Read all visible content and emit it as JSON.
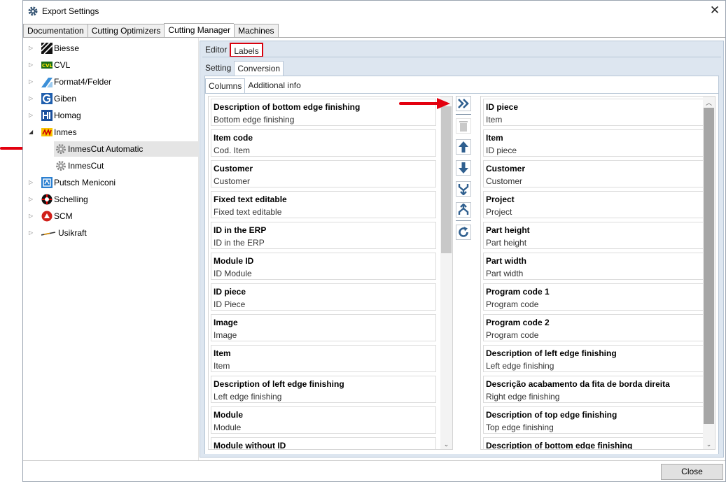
{
  "window": {
    "title": "Export Settings",
    "close_glyph": "✕"
  },
  "main_tabs": [
    {
      "label": "Documentation",
      "active": false
    },
    {
      "label": "Cutting Optimizers",
      "active": false
    },
    {
      "label": "Cutting Manager",
      "active": true
    },
    {
      "label": "Machines",
      "active": false
    }
  ],
  "tree": [
    {
      "label": "Biesse",
      "icon": "biesse-logo-icon",
      "expanded": false
    },
    {
      "label": "CVL",
      "icon": "cvl-logo-icon",
      "expanded": false
    },
    {
      "label": "Format4/Felder",
      "icon": "format4-logo-icon",
      "expanded": false
    },
    {
      "label": "Giben",
      "icon": "giben-logo-icon",
      "expanded": false
    },
    {
      "label": "Homag",
      "icon": "homag-logo-icon",
      "expanded": false
    },
    {
      "label": "Inmes",
      "icon": "inmes-logo-icon",
      "expanded": true
    },
    {
      "label": "InmesCut Automatic",
      "icon": "gear-icon",
      "child": true,
      "selected": true
    },
    {
      "label": "InmesCut",
      "icon": "gear-icon",
      "child": true
    },
    {
      "label": "Putsch Meniconi",
      "icon": "putsch-logo-icon",
      "expanded": false
    },
    {
      "label": "Schelling",
      "icon": "schelling-logo-icon",
      "expanded": false
    },
    {
      "label": "SCM",
      "icon": "scm-logo-icon",
      "expanded": false
    },
    {
      "label": "Usikraft",
      "icon": "usikraft-logo-icon",
      "expanded": false
    }
  ],
  "subtabs_level1": [
    {
      "label": "Editor"
    },
    {
      "label": "Labels",
      "active": true
    }
  ],
  "subtabs_level2": [
    {
      "label": "Setting"
    },
    {
      "label": "Conversion",
      "active": true
    }
  ],
  "subtabs_level3": [
    {
      "label": "Columns",
      "active": true
    },
    {
      "label": "Additional info"
    }
  ],
  "available_columns": [
    {
      "title": "Description of bottom edge finishing",
      "sub": "Bottom edge finishing"
    },
    {
      "title": "Item code",
      "sub": "Cod. Item"
    },
    {
      "title": "Customer",
      "sub": "Customer"
    },
    {
      "title": "Fixed text editable",
      "sub": "Fixed text editable"
    },
    {
      "title": "ID in the ERP",
      "sub": "ID in the ERP"
    },
    {
      "title": "Module ID",
      "sub": "ID Module"
    },
    {
      "title": "ID piece",
      "sub": "ID Piece"
    },
    {
      "title": "Image",
      "sub": "Image"
    },
    {
      "title": "Item",
      "sub": "Item"
    },
    {
      "title": "Description of left edge finishing",
      "sub": "Left edge finishing"
    },
    {
      "title": "Module",
      "sub": "Module"
    },
    {
      "title": "Module without ID",
      "sub": ""
    }
  ],
  "selected_columns": [
    {
      "title": "ID piece",
      "sub": "Item"
    },
    {
      "title": "Item",
      "sub": "ID piece"
    },
    {
      "title": "Customer",
      "sub": "Customer"
    },
    {
      "title": "Project",
      "sub": "Project"
    },
    {
      "title": "Part height",
      "sub": "Part height"
    },
    {
      "title": "Part width",
      "sub": "Part width"
    },
    {
      "title": "Program code 1",
      "sub": "Program code"
    },
    {
      "title": "Program code 2",
      "sub": "Program code"
    },
    {
      "title": "Description of left edge finishing",
      "sub": "Left edge finishing"
    },
    {
      "title": "Descrição acabamento da fita de borda direita",
      "sub": "Right edge finishing"
    },
    {
      "title": "Description of top edge finishing",
      "sub": "Top edge finishing"
    },
    {
      "title": "Description of bottom edge finishing",
      "sub": ""
    }
  ],
  "toolbar_icons": [
    "double-chevron-right-icon",
    "trash-icon",
    "arrow-up-icon",
    "arrow-down-icon",
    "merge-icon",
    "split-icon",
    "refresh-icon"
  ],
  "close_button": {
    "label": "Close"
  },
  "colors": {
    "accent_red": "#e3000f",
    "toolbar_blue": "#2f5f8f"
  }
}
